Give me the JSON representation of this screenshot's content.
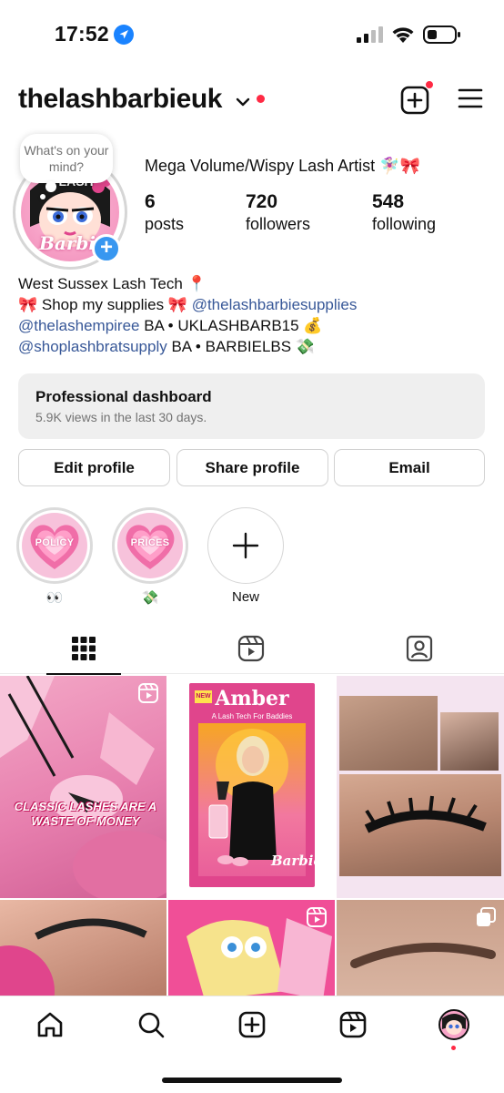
{
  "status_bar": {
    "time": "17:52"
  },
  "header": {
    "username": "thelashbarbieuk"
  },
  "profile": {
    "thought_bubble": "What's on your mind?",
    "avatar_text": {
      "top": "E LASH",
      "bottom": "Barbi"
    },
    "display_name": "Mega Volume/Wispy Lash Artist 🧚🏻‍♀️🎀",
    "stats": [
      {
        "value": "6",
        "label": "posts"
      },
      {
        "value": "720",
        "label": "followers"
      },
      {
        "value": "548",
        "label": "following"
      }
    ],
    "bio": {
      "line1": "West Sussex Lash Tech 📍",
      "line2_pre": "🎀 Shop my supplies 🎀 ",
      "line2_link": "@thelashbarbiesupplies",
      "line3_link": "@thelashempiree",
      "line3_rest": " BA • UKLASHBARB15 💰",
      "line4_link": "@shoplashbratsupply",
      "line4_rest": " BA • BARBIELBS 💸"
    }
  },
  "dashboard": {
    "title": "Professional dashboard",
    "subtitle": "5.9K views in the last 30 days."
  },
  "actions": {
    "edit": "Edit profile",
    "share": "Share profile",
    "email": "Email"
  },
  "highlights": [
    {
      "cover_text": "POLICY",
      "caption": "👀"
    },
    {
      "cover_text": "PRICES",
      "caption": "💸"
    },
    {
      "cover_text": "",
      "caption": "New"
    }
  ],
  "posts": {
    "post1_overlay": "CLASSIC LASHES ARE A WASTE OF MONEY",
    "post2_badge": "NEW",
    "post2_title": "Amber",
    "post2_subtitle": "A Lash Tech For Baddies",
    "post2_brand": "Barbie"
  },
  "colors": {
    "accent_blue": "#3897f0",
    "link": "#385898",
    "notification_red": "#ff2a44",
    "barbie_pink": "#e0458c"
  },
  "icons": [
    "location-arrow-icon",
    "signal-icon",
    "wifi-icon",
    "battery-icon",
    "chevron-down-icon",
    "create-icon",
    "menu-icon",
    "grid-icon",
    "reels-icon",
    "tagged-icon",
    "home-icon",
    "search-icon",
    "reels-nav-icon"
  ]
}
